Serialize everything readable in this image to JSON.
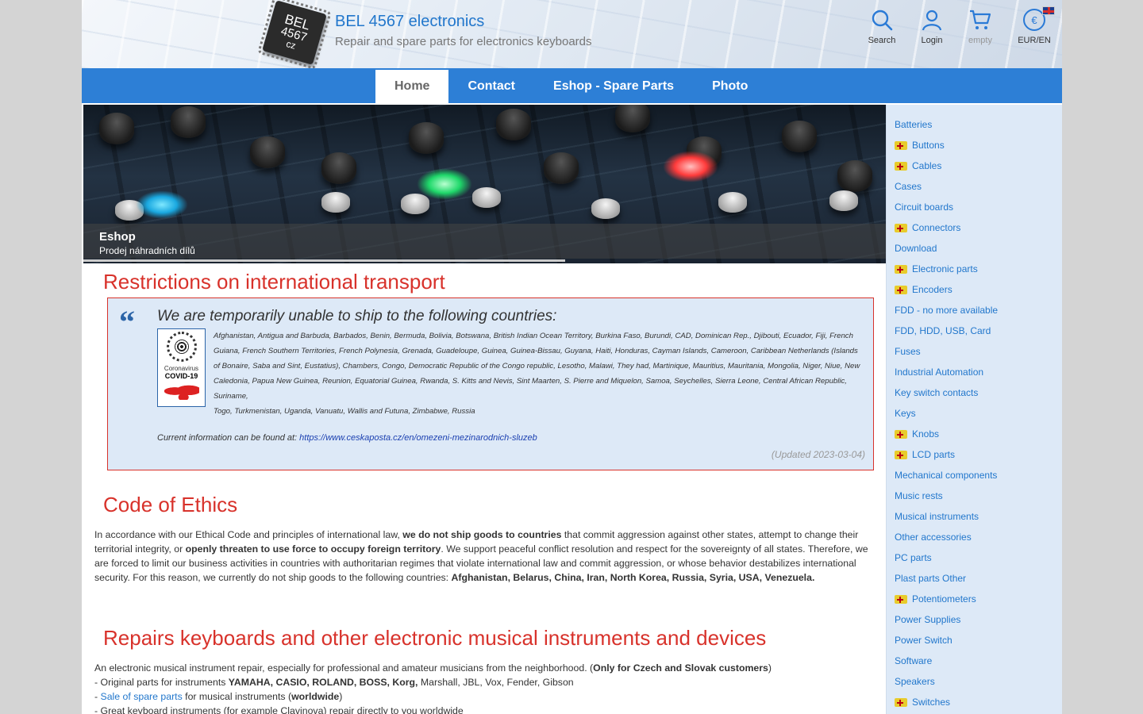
{
  "header": {
    "logo_lines": [
      "BEL",
      "4567",
      "cz"
    ],
    "title": "BEL 4567 electronics",
    "subtitle": "Repair and spare parts for electronics keyboards",
    "tools": {
      "search": "Search",
      "login": "Login",
      "cart": "empty",
      "currency_symbol": "€",
      "currency": "EUR/EN"
    }
  },
  "nav": {
    "items": [
      {
        "label": "Home",
        "active": true
      },
      {
        "label": "Contact"
      },
      {
        "label": "Eshop - Spare Parts"
      },
      {
        "label": "Photo"
      }
    ]
  },
  "banner": {
    "title": "Eshop",
    "subtitle": "Prodej náhradních dílů",
    "progress_fraction": 0.6
  },
  "restrictions": {
    "heading": "Restrictions on international transport",
    "quote_title": "We are temporarily unable to ship to the following countries:",
    "badge": {
      "line1": "Coronavirus",
      "line2": "COVID-19"
    },
    "countries": "Afghanistan, Antigua and Barbuda, Barbados, Benin, Bermuda, Bolivia, Botswana, British Indian Ocean Territory, Burkina Faso, Burundi, CAD, Dominican Rep., Djibouti, Ecuador, Fiji, French Guiana, French Southern Territories, French Polynesia, Grenada, Guadeloupe, Guinea, Guinea-Bissau, Guyana, Haiti, Honduras, Cayman Islands, Cameroon, Caribbean Netherlands (Islands of Bonaire, Saba and Sint, Eustatius), Chambers, Congo, Democratic Republic of the Congo republic, Lesotho, Malawi, They had, Martinique, Mauritius, Mauritania, Mongolia, Niger, Niue, New Caledonia, Papua New Guinea, Reunion, Equatorial Guinea, Rwanda, S. Kitts and Nevis, Sint Maarten, S. Pierre and Miquelon, Samoa, Seychelles, Sierra Leone, Central African Republic, Suriname,",
    "countries_end": "Togo, Turkmenistan, Uganda, Vanuatu, Wallis and Futuna, Zimbabwe, Russia",
    "info_prefix": "Current information can be found at: ",
    "info_link": "https://www.ceskaposta.cz/en/omezeni-mezinarodnich-sluzeb",
    "updated": "(Updated 2023-03-04)"
  },
  "ethics": {
    "heading": "Code of Ethics",
    "p1": "In accordance with our Ethical Code and principles of international law, ",
    "b1": "we do not ship goods to countries",
    "p2": " that commit aggression against other states, attempt to change their territorial integrity, or ",
    "b2": "openly threaten to use force to occupy foreign territory",
    "p3": ". We support peaceful conflict resolution and respect for the sovereignty of all states. Therefore, we are forced to limit our business activities in countries with authoritarian regimes that violate international law and commit aggression, or whose behavior destabilizes international security. For this reason, we currently do not ship goods to the following countries: ",
    "b3": "Afghanistan, Belarus, China, Iran, North Korea, Russia, Syria, USA, Venezuela."
  },
  "repairs": {
    "heading": "Repairs keyboards and other electronic musical instruments and devices",
    "l1a": "An electronic musical instrument repair, especially for professional and amateur musicians from the neighborhood. (",
    "l1b": "Only for Czech and Slovak customers",
    "l1c": ")",
    "l2a": "- Original parts for instruments ",
    "l2b": "YAMAHA, CASIO, ROLAND, BOSS, Korg,",
    "l2c": " Marshall, JBL, Vox, Fender, Gibson",
    "l3a": "- ",
    "l3link": "Sale of spare parts",
    "l3b": " for musical instruments (",
    "l3c": "worldwide",
    "l3d": ")",
    "l4": "- Great keyboard instruments (for example Clavinova) repair directly to you worldwide"
  },
  "sidebar": {
    "items": [
      {
        "label": "Batteries",
        "expandable": false
      },
      {
        "label": "Buttons",
        "expandable": true
      },
      {
        "label": "Cables",
        "expandable": true
      },
      {
        "label": "Cases",
        "expandable": false
      },
      {
        "label": "Circuit boards",
        "expandable": false
      },
      {
        "label": "Connectors",
        "expandable": true
      },
      {
        "label": "Download",
        "expandable": false
      },
      {
        "label": "Electronic parts",
        "expandable": true
      },
      {
        "label": "Encoders",
        "expandable": true
      },
      {
        "label": "FDD - no more available",
        "expandable": false
      },
      {
        "label": "FDD, HDD, USB, Card",
        "expandable": false
      },
      {
        "label": "Fuses",
        "expandable": false
      },
      {
        "label": "Industrial Automation",
        "expandable": false
      },
      {
        "label": "Key switch contacts",
        "expandable": false
      },
      {
        "label": "Keys",
        "expandable": false
      },
      {
        "label": "Knobs",
        "expandable": true
      },
      {
        "label": "LCD parts",
        "expandable": true
      },
      {
        "label": "Mechanical components",
        "expandable": false
      },
      {
        "label": "Music rests",
        "expandable": false
      },
      {
        "label": "Musical instruments",
        "expandable": false
      },
      {
        "label": "Other accessories",
        "expandable": false
      },
      {
        "label": "PC parts",
        "expandable": false
      },
      {
        "label": "Plast parts Other",
        "expandable": false
      },
      {
        "label": "Potentiometers",
        "expandable": true
      },
      {
        "label": "Power Supplies",
        "expandable": false
      },
      {
        "label": "Power Switch",
        "expandable": false
      },
      {
        "label": "Software",
        "expandable": false
      },
      {
        "label": "Speakers",
        "expandable": false
      },
      {
        "label": "Switches",
        "expandable": true
      }
    ]
  },
  "colors": {
    "accent": "#2d7fd6",
    "heading": "#d8322b",
    "link": "#2277cc",
    "sidebar_bg": "#dde9f7"
  }
}
